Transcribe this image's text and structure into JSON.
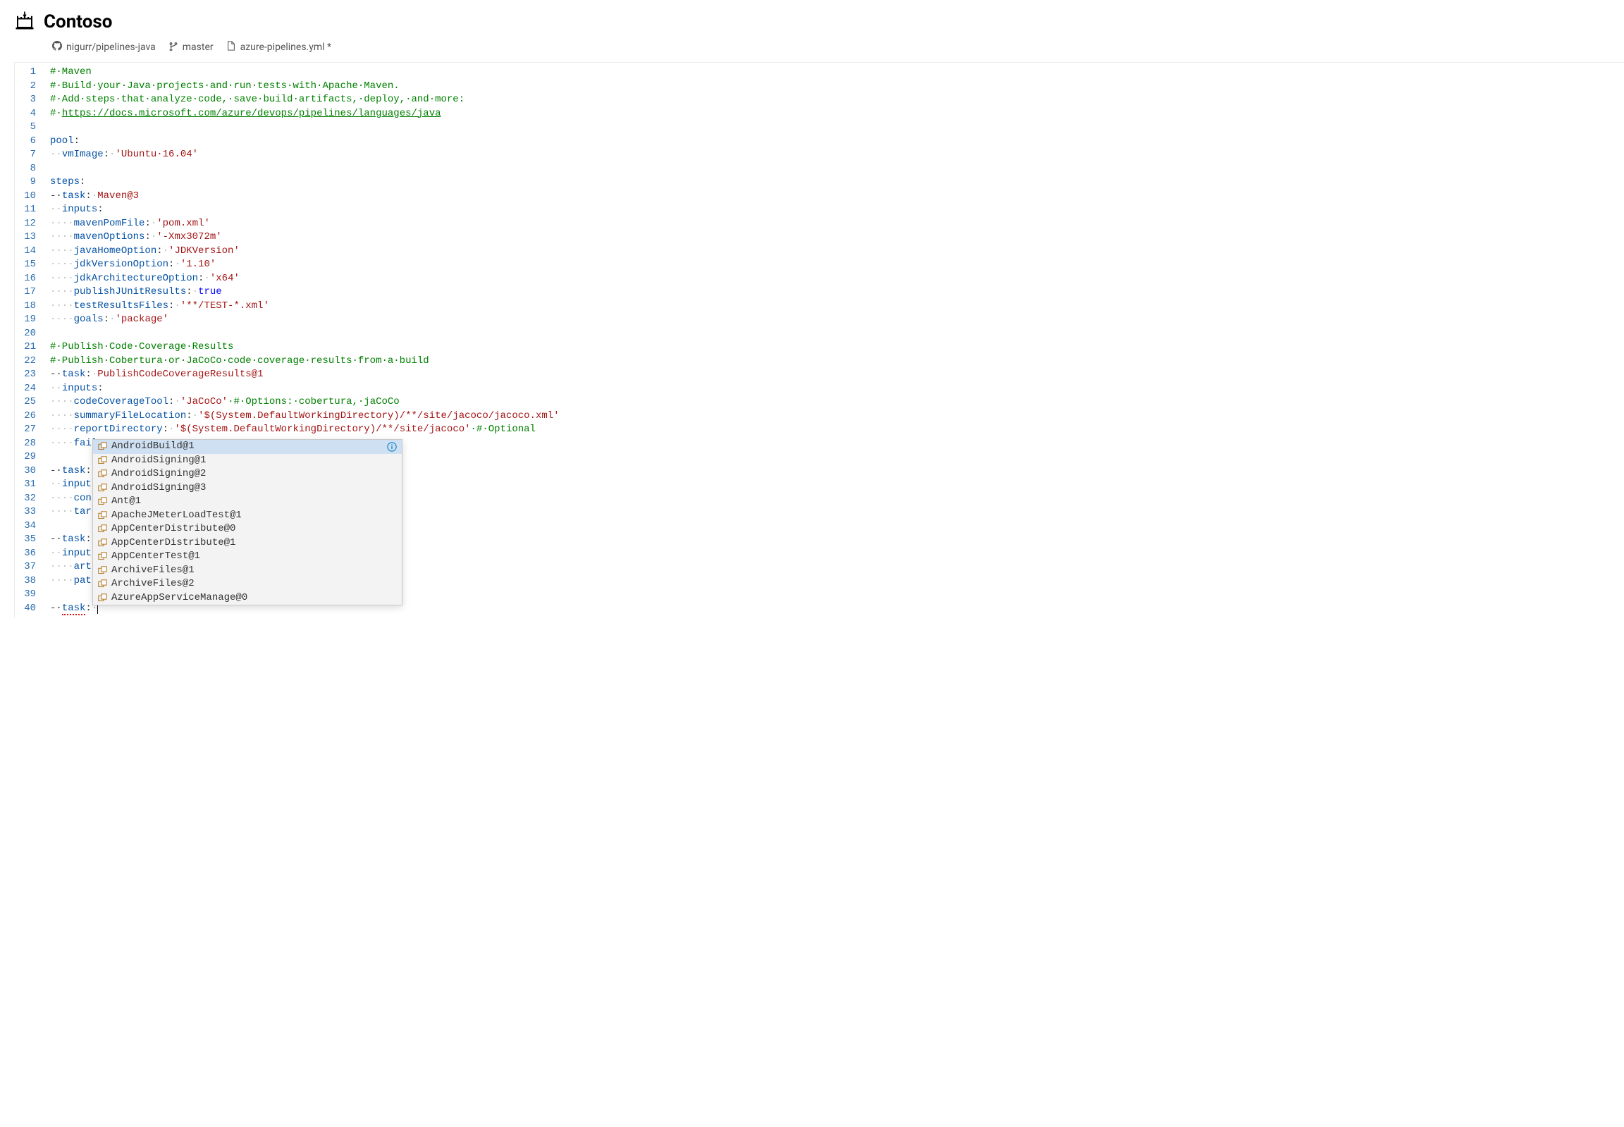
{
  "header": {
    "org_title": "Contoso"
  },
  "breadcrumb": {
    "repo": "nigurr/pipelines-java",
    "branch": "master",
    "file": "azure-pipelines.yml *"
  },
  "line_count": 40,
  "code": {
    "l1": "#·Maven",
    "l2": "#·Build·your·Java·projects·and·run·tests·with·Apache·Maven.",
    "l3": "#·Add·steps·that·analyze·code,·save·build·artifacts,·deploy,·and·more:",
    "l4_prefix": "#·",
    "l4_link": "https://docs.microsoft.com/azure/devops/pipelines/languages/java",
    "l6_key": "pool",
    "l7_ws": "··",
    "l7_key": "vmImage",
    "l7_val": "'Ubuntu·16.04'",
    "l9_key": "steps",
    "l10_dash": "-·",
    "l10_key": "task",
    "l10_val": "Maven@3",
    "l11_ws": "··",
    "l11_key": "inputs",
    "l12_ws": "····",
    "l12_key": "mavenPomFile",
    "l12_val": "'pom.xml'",
    "l13_key": "mavenOptions",
    "l13_val": "'-Xmx3072m'",
    "l14_key": "javaHomeOption",
    "l14_val": "'JDKVersion'",
    "l15_key": "jdkVersionOption",
    "l15_val": "'1.10'",
    "l16_key": "jdkArchitectureOption",
    "l16_val": "'x64'",
    "l17_key": "publishJUnitResults",
    "l17_val": "true",
    "l18_key": "testResultsFiles",
    "l18_val": "'**/TEST-*.xml'",
    "l19_key": "goals",
    "l19_val": "'package'",
    "l21": "#·Publish·Code·Coverage·Results",
    "l22": "#·Publish·Cobertura·or·JaCoCo·code·coverage·results·from·a·build",
    "l23_key": "task",
    "l23_val": "PublishCodeCoverageResults@1",
    "l24_key": "inputs",
    "l25_key": "codeCoverageTool",
    "l25_val": "'JaCoCo'",
    "l25_comment": "·#·Options:·cobertura,·jaCoCo",
    "l26_key": "summaryFileLocation",
    "l26_val": "'$(System.DefaultWorkingDirectory)/**/site/jacoco/jacoco.xml'",
    "l27_key": "reportDirectory",
    "l27_val": "'$(System.DefaultWorkingDirectory)/**/site/jacoco'",
    "l27_comment": "·#·Optional",
    "l28_text": "fail",
    "l30_key": "task",
    "l31_key": "inputs",
    "l32_key": "cont",
    "l33_key": "targ",
    "l35_key": "task",
    "l36_key": "inputs",
    "l37_key": "arti",
    "l38_key": "path",
    "l40_key": "task"
  },
  "autocomplete": {
    "items": [
      "AndroidBuild@1",
      "AndroidSigning@1",
      "AndroidSigning@2",
      "AndroidSigning@3",
      "Ant@1",
      "ApacheJMeterLoadTest@1",
      "AppCenterDistribute@0",
      "AppCenterDistribute@1",
      "AppCenterTest@1",
      "ArchiveFiles@1",
      "ArchiveFiles@2",
      "AzureAppServiceManage@0"
    ],
    "selected_index": 0
  }
}
